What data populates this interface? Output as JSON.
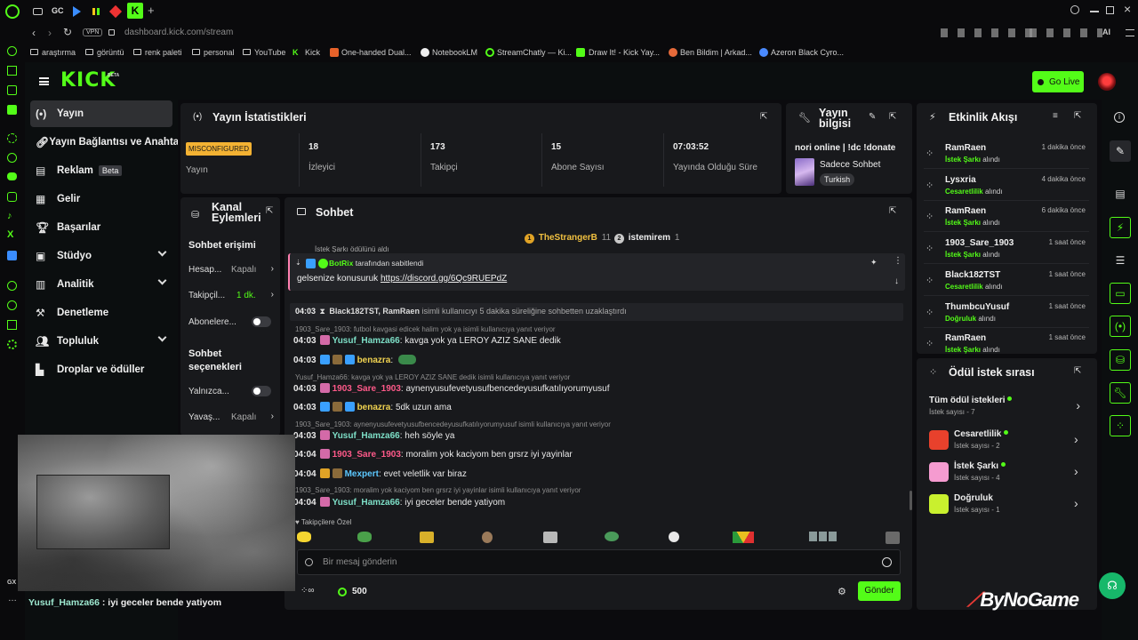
{
  "browser": {
    "tabs": [
      "GC"
    ],
    "url": "dashboard.kick.com/stream",
    "vpn": "VPN",
    "ai_label": "AI",
    "bookmarks": [
      "araştırma",
      "görüntü",
      "renk paleti",
      "personal",
      "YouTube",
      "Kick",
      "One-handed Dual...",
      "NotebookLM",
      "StreamChatly — Ki...",
      "Draw It! - Kick Yay...",
      "Ben Bildim | Arkad...",
      "Azeron Black Cyro..."
    ],
    "gx_label": "GX"
  },
  "header": {
    "logo": "KICK",
    "logo_beta": "BETA",
    "go_live": "Go Live"
  },
  "nav": {
    "items": [
      {
        "label": "Yayın",
        "active": true,
        "icon": "broadcast-icon"
      },
      {
        "label": "Yayın Bağlantısı ve Anahtarı",
        "icon": "link-icon"
      },
      {
        "label": "Reklam",
        "badge": "Beta",
        "icon": "ad-icon"
      },
      {
        "label": "Gelir",
        "icon": "revenue-icon"
      },
      {
        "label": "Başarılar",
        "icon": "trophy-icon"
      },
      {
        "label": "Stüdyo",
        "icon": "studio-icon",
        "expand": true
      },
      {
        "label": "Analitik",
        "icon": "analytics-icon",
        "expand": true
      },
      {
        "label": "Denetleme",
        "icon": "hammer-icon"
      },
      {
        "label": "Topluluk",
        "icon": "community-icon",
        "expand": true
      },
      {
        "label": "Droplar ve ödüller",
        "icon": "drops-icon"
      }
    ]
  },
  "stats": {
    "title": "Yayın İstatistikleri",
    "status_badge": "MISCONFIGURED",
    "status_label": "Yayın",
    "cells": [
      {
        "value": "18",
        "label": "İzleyici"
      },
      {
        "value": "173",
        "label": "Takipçi"
      },
      {
        "value": "15",
        "label": "Abone Sayısı"
      },
      {
        "value": "07:03:52",
        "label": "Yayında Olduğu Süre"
      }
    ]
  },
  "stream_info": {
    "title_line1": "Yayın",
    "title_line2": "bilgisi",
    "stream_title": "nori online | !dc !donate",
    "category": "Sadece Sohbet",
    "language": "Turkish"
  },
  "activity": {
    "title": "Etkinlik Akışı",
    "items": [
      {
        "name": "RamRaen",
        "sub_hl": "İstek Şarkı",
        "sub": "alındı",
        "time": "1 dakika önce"
      },
      {
        "name": "Lysxria",
        "sub_hl": "Cesaretlilik",
        "sub": "alındı",
        "time": "4 dakika önce"
      },
      {
        "name": "RamRaen",
        "sub_hl": "İstek Şarkı",
        "sub": "alındı",
        "time": "6 dakika önce"
      },
      {
        "name": "1903_Sare_1903",
        "sub_hl": "İstek Şarkı",
        "sub": "alındı",
        "time": "1 saat önce"
      },
      {
        "name": "Black182TST",
        "sub_hl": "Cesaretlilik",
        "sub": "alındı",
        "time": "1 saat önce"
      },
      {
        "name": "ThumbcuYusuf",
        "sub_hl": "Doğruluk",
        "sub": "alındı",
        "time": "1 saat önce"
      },
      {
        "name": "RamRaen",
        "sub_hl": "İstek Şarkı",
        "sub": "alındı",
        "time": "1 saat önce"
      }
    ]
  },
  "rewards": {
    "title": "Ödül istek sırası",
    "all_label": "Tüm ödül istekleri",
    "all_count": "İstek sayısı - 7",
    "items": [
      {
        "name": "Cesaretlilik",
        "count": "İstek sayısı - 2",
        "color": "#e8412c"
      },
      {
        "name": "İstek Şarkı",
        "count": "İstek sayısı - 4",
        "color": "#f59bd0"
      },
      {
        "name": "Doğruluk",
        "count": "İstek sayısı - 1",
        "color": "#c9f02e"
      }
    ]
  },
  "channel_actions": {
    "title_line1": "Kanal",
    "title_line2": "Eylemleri",
    "chat_access": "Sohbet erişimi",
    "rows": [
      {
        "label": "Hesap...",
        "value": "Kapalı"
      },
      {
        "label": "Takipçil...",
        "value": "1 dk."
      },
      {
        "label": "Abonelere..."
      }
    ],
    "chat_options_line1": "Sohbet",
    "chat_options_line2": "seçenekleri",
    "rows2": [
      {
        "label": "Yalnızca..."
      },
      {
        "label": "Yavaş...",
        "value": "Kapalı"
      }
    ]
  },
  "chat": {
    "title": "Sohbet",
    "top_gifters": [
      {
        "rank": "1",
        "name": "TheStrangerB",
        "count": "11"
      },
      {
        "rank": "2",
        "name": "istemirem",
        "count": "1"
      }
    ],
    "cut_line": "İstek Şarkı ödülünü aldı",
    "pinned": {
      "author": "BotRix",
      "text": "tarafından sabitlendi",
      "message_prefix": "gelsenize konusuruk ",
      "link": "https://discord.gg/6Qc9RUEPdZ"
    },
    "timeout": {
      "time": "04:03",
      "users": "Black182TST, RamRaen",
      "text": "isimli kullanıcıyı 5 dakika süreliğine sohbetten uzaklaştırdı"
    },
    "messages": [
      {
        "reply": "1903_Sare_1903: futbol kavgasi edicek halim yok ya isimli kullanıcıya yanıt veriyor",
        "time": "04:03",
        "user": "Yusuf_Hamza66",
        "color": "#7ee0c8",
        "text": "kavga yok ya LEROY AZIZ SANE dedik"
      },
      {
        "time": "04:03",
        "user": "benazra",
        "color": "#f0d250",
        "text": ""
      },
      {
        "reply": "Yusuf_Hamza66: kavga yok ya LEROY AZIZ SANE dedik isimli kullanıcıya yanıt veriyor",
        "time": "04:03",
        "user": "1903_Sare_1903",
        "color": "#ff5a8a",
        "text": "aynenyusufevetyusufbencedeyusufkatılıyorumyusuf"
      },
      {
        "time": "04:03",
        "user": "benazra",
        "color": "#f0d250",
        "text": "5dk uzun ama"
      },
      {
        "reply": "1903_Sare_1903: aynenyusufevetyusufbencedeyusufkatılıyorumyusuf isimli kullanıcıya yanıt veriyor",
        "time": "04:03",
        "user": "Yusuf_Hamza66",
        "color": "#7ee0c8",
        "text": "heh söyle ya"
      },
      {
        "time": "04:04",
        "user": "1903_Sare_1903",
        "color": "#ff5a8a",
        "text": "moralim yok kaciyom ben grsrz iyi yayinlar"
      },
      {
        "time": "04:04",
        "user": "Mexpert",
        "color": "#5cc8ff",
        "text": "evet veletlik var biraz"
      },
      {
        "reply": "1903_Sare_1903: moralim yok kaciyom ben grsrz iyi yayinlar isimli kullanıcıya yanıt veriyor",
        "time": "04:04",
        "user": "Yusuf_Hamza66",
        "color": "#7ee0c8",
        "text": "iyi geceler bende yatiyom"
      }
    ],
    "emotes_label": "Takipçilere Özel",
    "input_placeholder": "Bir mesaj gönderin",
    "points": "500",
    "send": "Gönder"
  },
  "overlay": {
    "user": "Yusuf_Hamza66",
    "text": " : iyi geceler bende yatiyom",
    "watermark": "ByNoGame"
  }
}
